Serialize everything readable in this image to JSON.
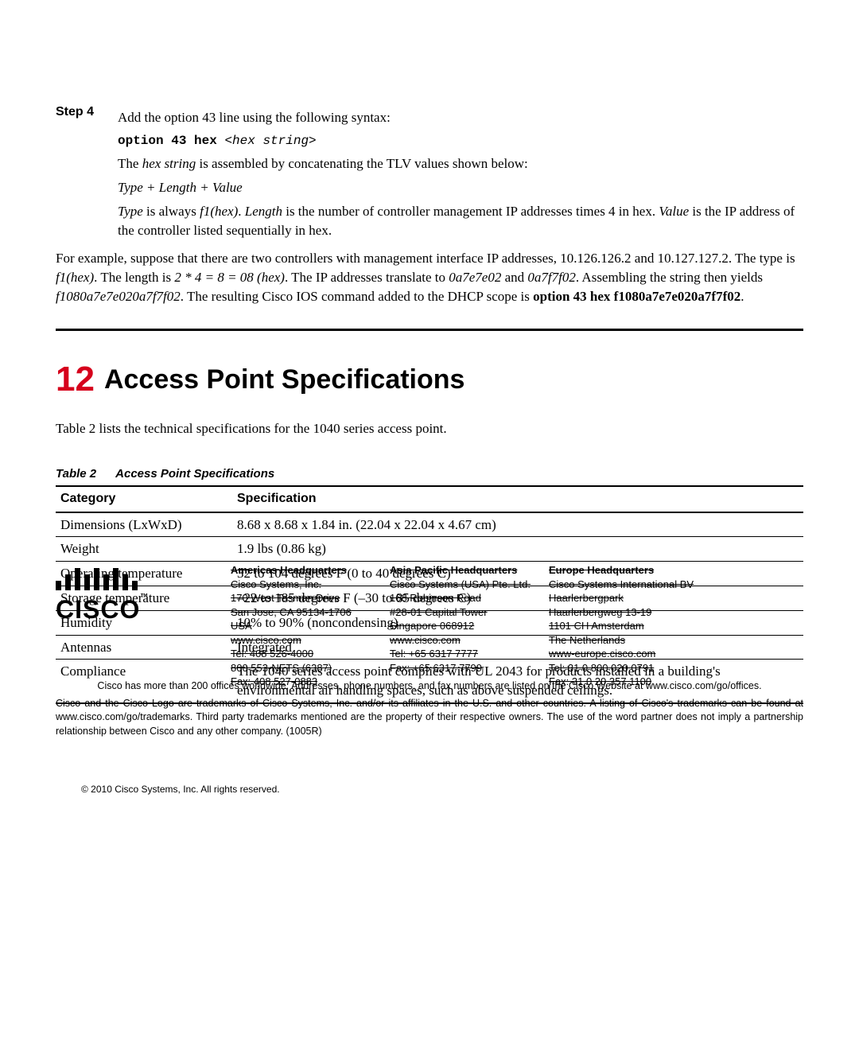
{
  "step": {
    "label": "Step 4",
    "text1": "Add the option 43 line using the following syntax:",
    "code": "option 43 hex",
    "code_arg": "<hex string>",
    "text2a": "The ",
    "text2b": "hex string",
    "text2c": " is assembled by concatenating the TLV values shown below:",
    "formula": "Type + Length + Value",
    "text3a": "Type",
    "text3b": " is always ",
    "text3c": "f1(hex)",
    "text3d": ". ",
    "text3e": "Length",
    "text3f": " is the number of controller management IP addresses times 4 in hex. ",
    "text3g": "Value",
    "text3h": " is the IP address of the controller listed sequentially in hex."
  },
  "example": {
    "p1a": "For example, suppose that there are two controllers with management interface IP addresses, 10.126.126.2 and 10.127.127.2. The type is ",
    "p1b": "f1(hex)",
    "p1c": ". The length is ",
    "p1d": "2 * 4 = 8 = 08 (hex)",
    "p1e": ". The IP addresses translate to ",
    "p1f": "0a7e7e02",
    "p1g": " and ",
    "p1h": "0a7f7f02",
    "p1i": ". Assembling the string then yields ",
    "p1j": "f1080a7e7e020a7f7f02",
    "p1k": ". The resulting Cisco IOS command added to the DHCP scope is ",
    "p1l": "option 43 hex f1080a7e7e020a7f7f02",
    "p1m": "."
  },
  "section": {
    "num": "12",
    "title": "Access Point Specifications"
  },
  "intro": "Table 2 lists the technical specifications for the 1040 series access point.",
  "table_caption_left": "Table 2",
  "table_caption_right": "Access Point Specifications",
  "table": {
    "h1": "Category",
    "h2": "Specification",
    "rows": [
      {
        "c": "Dimensions (LxWxD)",
        "s": "8.68 x 8.68 x 1.84 in. (22.04 x 22.04 x 4.67 cm)"
      },
      {
        "c": "Weight",
        "s": "1.9 lbs (0.86 kg)"
      },
      {
        "c": "Operating temperature",
        "s": "32 to 104 degrees F (0 to 40 degrees C)"
      },
      {
        "c": "Storage temperature",
        "s": "–22 to 185 degrees F (–30 to 85 degrees C)"
      },
      {
        "c": "Humidity",
        "s": "10% to 90% (noncondensing)"
      },
      {
        "c": "Antennas",
        "s": "Integrated"
      },
      {
        "c": "Compliance",
        "s": "The 1040 series access point complies with UL 2043 for products installed in a building's environmental air handling spaces, such as above suspended ceilings."
      }
    ]
  },
  "hq1": {
    "title": "Americas Headquarters",
    "l1": "Cisco Systems, Inc.",
    "l2": "170 West Tasman Drive",
    "l3": "San Jose, CA 95134-1706",
    "l4": "USA",
    "l5": "www.cisco.com",
    "l6": "Tel: 408 526-4000",
    "l7": "800 553-NETS (6387)",
    "l8": "Fax: 408 527-0883"
  },
  "hq2": {
    "title": "Asia Pacific Headquarters",
    "l1": "Cisco Systems (USA) Pte. Ltd.",
    "l2": "168 Robinson Road",
    "l3": "#28-01 Capital Tower",
    "l4": "Singapore 068912",
    "l5": "www.cisco.com",
    "l6": "Tel: +65 6317 7777",
    "l7": "Fax: +65 6317 7799"
  },
  "hq3": {
    "title": "Europe Headquarters",
    "l1": "Cisco Systems International BV",
    "l2": "Haarlerbergpark",
    "l3": "Haarlerbergweg 13-19",
    "l4": "1101 CH Amsterdam",
    "l5": "The Netherlands",
    "l6": "www-europe.cisco.com",
    "l7": "Tel: 31 0 800 020 0791",
    "l8": "Fax: 31 0 20 357 1100"
  },
  "footer1": "Cisco has more than 200 offices worldwide. Addresses, phone numbers, and fax numbers are listed on the Cisco Website at www.cisco.com/go/offices.",
  "footer2": "Cisco and the Cisco Logo are trademarks of Cisco Systems, Inc. and/or its affiliates in the U.S. and other countries. A listing of Cisco's trademarks can be found at www.cisco.com/go/trademarks. Third party trademarks mentioned are the property of their respective owners. The use of the word partner does not imply a partnership relationship between Cisco and any other company. (1005R)",
  "copyright": "© 2010 Cisco Systems, Inc. All rights reserved."
}
